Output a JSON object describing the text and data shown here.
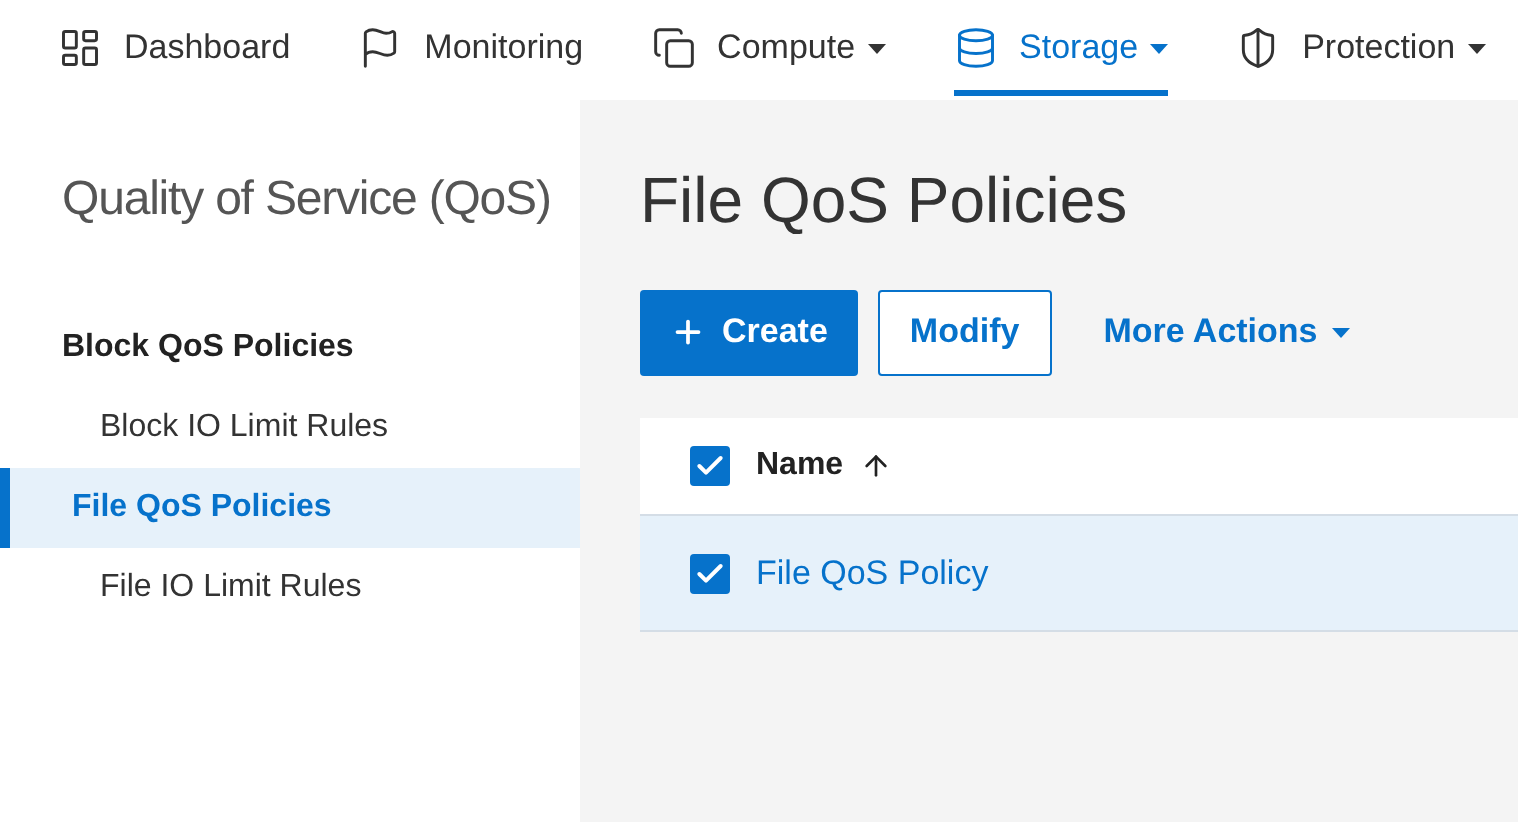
{
  "nav": [
    {
      "label": "Dashboard",
      "has_menu": false,
      "selected": false
    },
    {
      "label": "Monitoring",
      "has_menu": false,
      "selected": false
    },
    {
      "label": "Compute",
      "has_menu": true,
      "selected": false
    },
    {
      "label": "Storage",
      "has_menu": true,
      "selected": true
    },
    {
      "label": "Protection",
      "has_menu": true,
      "selected": false
    }
  ],
  "sidebar": {
    "title": "Quality of Service (QoS)",
    "items": [
      {
        "label": "Block QoS Policies",
        "selected": false,
        "children": [
          {
            "label": "Block IO Limit Rules",
            "selected": false
          }
        ]
      },
      {
        "label": "File QoS Policies",
        "selected": true,
        "children": [
          {
            "label": "File IO Limit Rules",
            "selected": false
          }
        ]
      }
    ]
  },
  "page": {
    "title": "File QoS Policies"
  },
  "actions": [
    {
      "label": "Create",
      "kind": "primary"
    },
    {
      "label": "Modify",
      "kind": "outline"
    },
    {
      "label": "More Actions",
      "kind": "menu"
    }
  ],
  "table": {
    "header_checked": true,
    "columns": [
      {
        "label": "Name"
      }
    ],
    "rows": [
      {
        "name": "File QoS Policy",
        "checked": true,
        "selected": true
      }
    ]
  }
}
